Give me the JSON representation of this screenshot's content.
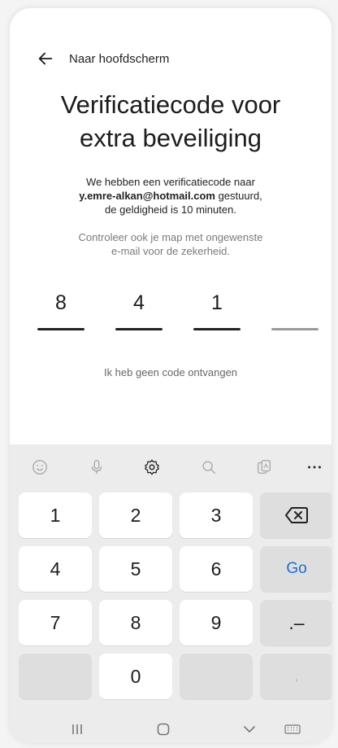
{
  "header": {
    "back_label": "Naar hoofdscherm"
  },
  "title": {
    "line1": "Verificatiecode voor",
    "line2": "extra beveiliging"
  },
  "description": {
    "line1": "We hebben een verificatiecode naar",
    "email": "y.emre-alkan@hotmail.com",
    "line2_suffix": " gestuurd,",
    "line3": "de geldigheid is 10 minuten."
  },
  "note": {
    "line1": "Controleer ook je map met ongewenste",
    "line2": "e-mail voor de zekerheid."
  },
  "otp": {
    "digits": [
      "8",
      "4",
      "1",
      ""
    ]
  },
  "resend_link": "Ik heb geen code ontvangen",
  "keyboard": {
    "toolbar_icons": [
      "emoji-icon",
      "microphone-icon",
      "settings-icon",
      "search-icon",
      "clipboard-icon",
      "more-icon"
    ],
    "keys": {
      "k1": "1",
      "k2": "2",
      "k3": "3",
      "k4": "4",
      "k5": "5",
      "k6": "6",
      "k7": "7",
      "k8": "8",
      "k9": "9",
      "k0": "0",
      "go": "Go",
      "dot_dash": ".–",
      "comma": ","
    }
  },
  "navbar_icons": [
    "recent-apps-icon",
    "home-icon",
    "back-chevron-icon",
    "keyboard-icon"
  ],
  "colors": {
    "accent": "#1a6fd1",
    "background": "#ffffff",
    "keyboard_bg": "#ececec"
  }
}
